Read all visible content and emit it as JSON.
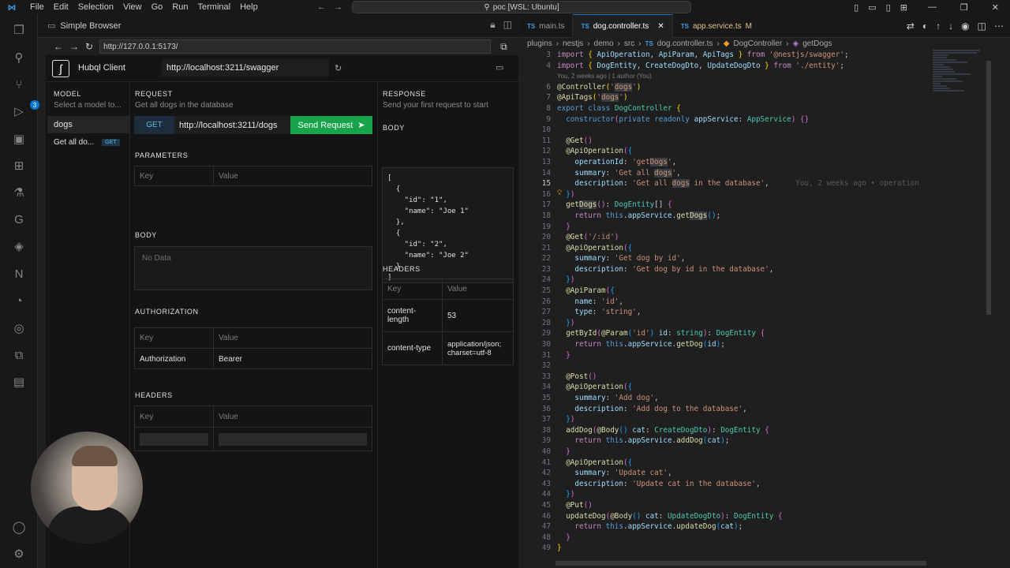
{
  "titlebar": {
    "menu": [
      "File",
      "Edit",
      "Selection",
      "View",
      "Go",
      "Run",
      "Terminal",
      "Help"
    ],
    "search": "poc [WSL: Ubuntu]"
  },
  "activity": {
    "badge": "3"
  },
  "simple_browser": {
    "tab_label": "Simple Browser",
    "url": "http://127.0.0.1:5173/"
  },
  "hubql": {
    "app_name": "Hubql Client",
    "api_url": "http://localhost:3211/swagger",
    "model": {
      "title": "MODEL",
      "subtitle": "Select a model to...",
      "items": [
        {
          "label": "dogs"
        },
        {
          "label": "Get all do...",
          "tag": "GET"
        }
      ]
    },
    "request": {
      "title": "REQUEST",
      "subtitle": "Get all dogs in the database",
      "method": "GET",
      "url": "http://localhost:3211/dogs",
      "send_label": "Send Request",
      "parameters": {
        "title": "PARAMETERS",
        "key_placeholder": "Key",
        "value_placeholder": "Value"
      },
      "body": {
        "title": "BODY",
        "placeholder": "No Data"
      },
      "authorization": {
        "title": "AUTHORIZATION",
        "key_header": "Key",
        "value_header": "Value",
        "key": "Authorization",
        "value": "Bearer"
      },
      "headers": {
        "title": "HEADERS",
        "key_header": "Key",
        "value_header": "Value"
      }
    },
    "response": {
      "title": "RESPONSE",
      "subtitle": "Send your first request to start",
      "body_title": "BODY",
      "body_text": "[\n  {\n    \"id\": \"1\",\n    \"name\": \"Joe 1\"\n  },\n  {\n    \"id\": \"2\",\n    \"name\": \"Joe 2\"\n  }\n]",
      "headers_title": "HEADERS",
      "headers_key": "Key",
      "headers_value": "Value",
      "headers": [
        {
          "key": "content-length",
          "value": "53"
        },
        {
          "key": "content-type",
          "value": "application/json; charset=utf-8"
        }
      ]
    }
  },
  "editor": {
    "tabs": [
      {
        "label": "main.ts",
        "active": false,
        "modified": ""
      },
      {
        "label": "dog.controller.ts",
        "active": true,
        "modified": ""
      },
      {
        "label": "app.service.ts",
        "active": false,
        "modified": "M"
      }
    ],
    "breadcrumb": [
      "plugins",
      "nestjs",
      "demo",
      "src",
      "dog.controller.ts",
      "DogController",
      "getDogs"
    ],
    "codelens": "You, 2 weeks ago | 1 author (You)",
    "blame": "You, 2 weeks ago • operation",
    "current_line": 15,
    "line_numbers": [
      3,
      4,
      null,
      6,
      7,
      8,
      9,
      10,
      11,
      12,
      13,
      14,
      15,
      16,
      17,
      18,
      19,
      20,
      21,
      22,
      23,
      24,
      25,
      26,
      27,
      28,
      29,
      30,
      31,
      32,
      33,
      34,
      35,
      36,
      37,
      38,
      39,
      40,
      41,
      42,
      43,
      44,
      45,
      46,
      47,
      48,
      49
    ]
  }
}
